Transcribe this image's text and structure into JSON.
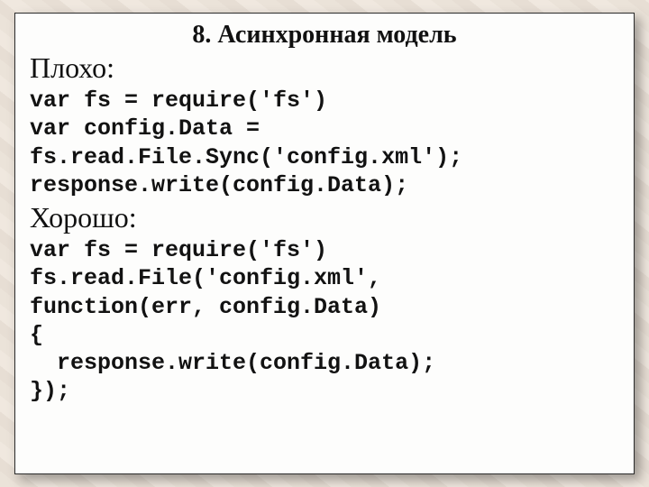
{
  "title": "8. Асинхронная модель",
  "bad_label": "Плохо:",
  "bad_code": "var fs = require('fs')\nvar config.Data =\nfs.read.File.Sync('config.xml');\nresponse.write(config.Data);",
  "good_label": "Хорошо:",
  "good_code": "var fs = require('fs')\nfs.read.File('config.xml',\nfunction(err, config.Data)\n{\n  response.write(config.Data);\n});"
}
